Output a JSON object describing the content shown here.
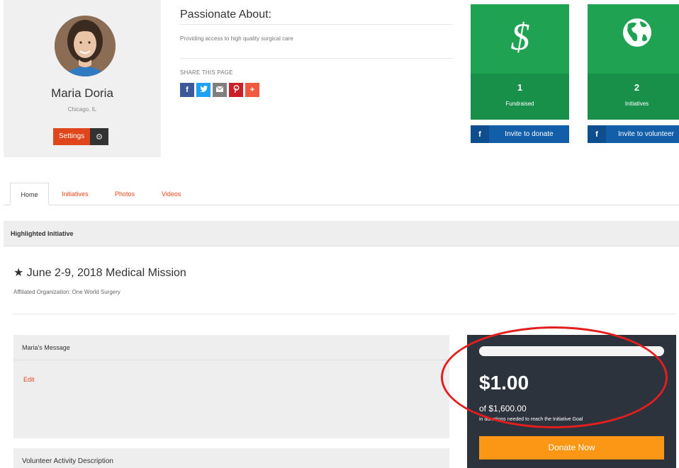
{
  "profile": {
    "name": "Maria Doria",
    "location": "Chicago, IL",
    "settings_label": "Settings"
  },
  "passion": {
    "title": "Passionate About:",
    "text": "Providing access to high quality surgical care",
    "share_title": "SHARE THIS PAGE",
    "share_buttons": [
      {
        "icon": "facebook-icon",
        "glyph": "f",
        "color": "#3b5998"
      },
      {
        "icon": "twitter-icon",
        "glyph": "t",
        "color": "#1da1f2"
      },
      {
        "icon": "email-icon",
        "glyph": "✉",
        "color": "#7f7f7f"
      },
      {
        "icon": "pinterest-icon",
        "glyph": "p",
        "color": "#cb2027"
      },
      {
        "icon": "plus-icon",
        "glyph": "+",
        "color": "#f05a3e"
      }
    ]
  },
  "stats": [
    {
      "icon": "dollar-icon",
      "value": "1",
      "label": "Fundraised",
      "invite": "Invite to donate"
    },
    {
      "icon": "globe-icon",
      "value": "2",
      "label": "Initiatives",
      "invite": "Invite to volunteer"
    }
  ],
  "tabs": [
    {
      "label": "Home"
    },
    {
      "label": "Initiatives"
    },
    {
      "label": "Photos"
    },
    {
      "label": "Videos"
    }
  ],
  "highlight": {
    "header": "Highlighted Initiative",
    "star": "★",
    "title": "June 2-9, 2018 Medical Mission",
    "org": "Affiliated Organization: One World Surgery"
  },
  "message": {
    "header": "Maria's Message",
    "edit": "Edit"
  },
  "volunteer": {
    "header": "Volunteer Activity Description"
  },
  "donation": {
    "amount": "$1.00",
    "goal": "of $1,600.00",
    "note": "in donations needed to reach the Initiative Goal",
    "button": "Donate Now",
    "progress_fraction": 0.000625
  },
  "colors": {
    "accent": "#e0461b",
    "green": "#1fa353",
    "facebook_blue": "#135ea8",
    "orange": "#fb9714",
    "annotation_red": "#e41e1e"
  }
}
